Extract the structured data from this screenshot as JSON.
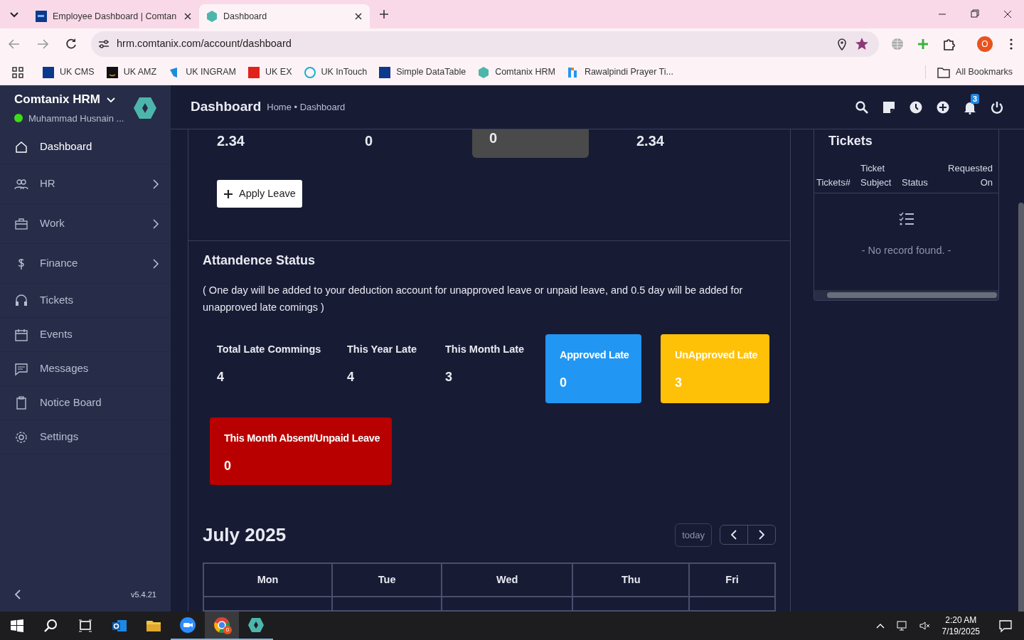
{
  "browser": {
    "tabs": [
      {
        "title": "Employee Dashboard | Comtan",
        "selected": false
      },
      {
        "title": "Dashboard",
        "selected": true
      }
    ],
    "url": "hrm.comtanix.com/account/dashboard",
    "profile": "O",
    "bookmarks": [
      "UK CMS",
      "UK AMZ",
      "UK INGRAM",
      "UK EX",
      "UK InTouch",
      "Simple DataTable",
      "Comtanix HRM",
      "Rawalpindi Prayer Ti..."
    ],
    "all_bookmarks": "All Bookmarks"
  },
  "sidebar": {
    "brand": "Comtanix HRM",
    "user": "Muhammad Husnain ...",
    "online": true,
    "items": [
      {
        "label": "Dashboard",
        "selected": true,
        "has_children": false
      },
      {
        "label": "HR",
        "selected": false,
        "has_children": true
      },
      {
        "label": "Work",
        "selected": false,
        "has_children": true
      },
      {
        "label": "Finance",
        "selected": false,
        "has_children": true
      },
      {
        "label": "Tickets",
        "selected": false,
        "has_children": false
      },
      {
        "label": "Events",
        "selected": false,
        "has_children": false
      },
      {
        "label": "Messages",
        "selected": false,
        "has_children": false
      },
      {
        "label": "Notice Board",
        "selected": false,
        "has_children": false
      },
      {
        "label": "Settings",
        "selected": false,
        "has_children": false
      }
    ],
    "version": "v5.4.21"
  },
  "header": {
    "title": "Dashboard",
    "breadcrumb": "Home • Dashboard",
    "notifications": "3"
  },
  "top_stats": [
    {
      "value": "2.34",
      "kind": "plain"
    },
    {
      "value": "0",
      "kind": "plain"
    },
    {
      "value": "0",
      "kind": "box"
    },
    {
      "value": "2.34",
      "kind": "plain"
    }
  ],
  "apply_leave": "Apply Leave",
  "attendance": {
    "title": "Attandence Status",
    "note": "( One day will be added to your deduction account for unapproved leave or unpaid leave, and 0.5 day will be added for unapproved late comings )",
    "stats": [
      {
        "label": "Total Late Commings",
        "value": "4"
      },
      {
        "label": "This Year Late",
        "value": "4"
      },
      {
        "label": "This Month Late",
        "value": "3"
      }
    ],
    "cards": [
      {
        "label": "Approved Late",
        "value": "0",
        "color": "#2196f3"
      },
      {
        "label": "UnApproved Late",
        "value": "3",
        "color": "#ffc107"
      },
      {
        "label": "This Month Absent/Unpaid Leave",
        "value": "0",
        "color": "#b80000"
      }
    ]
  },
  "calendar": {
    "title": "July 2025",
    "today": "today",
    "days": [
      "Mon",
      "Tue",
      "Wed",
      "Thu",
      "Fri"
    ]
  },
  "tickets": {
    "title": "Tickets",
    "columns": [
      "Tickets#",
      "Ticket Subject",
      "Status",
      "Requested On"
    ],
    "empty": "- No record found. -"
  },
  "taskbar": {
    "time": "2:20 AM",
    "date": "7/19/2025",
    "browser_badge": "0"
  }
}
